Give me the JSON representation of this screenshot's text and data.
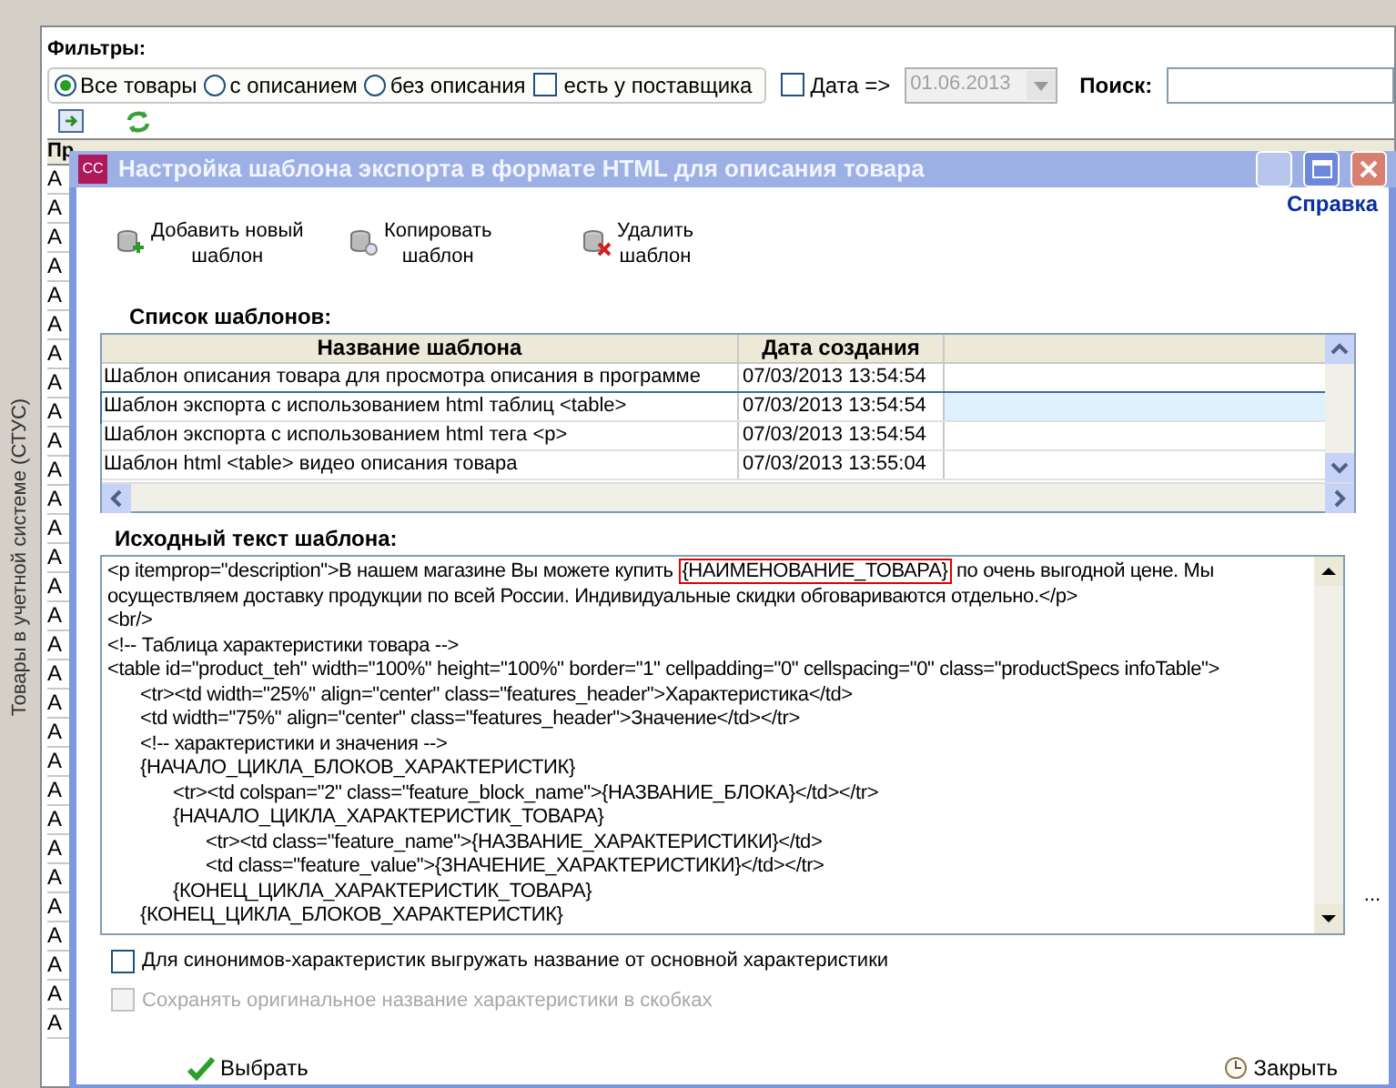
{
  "main": {
    "side_label": "Товары в учетной системе (СТУС)",
    "filters_title": "Фильтры:",
    "radios": [
      {
        "label": "Все товары",
        "selected": true
      },
      {
        "label": "с описанием",
        "selected": false
      },
      {
        "label": "без описания",
        "selected": false
      }
    ],
    "supplier": {
      "label": "есть у поставщика",
      "checked": false
    },
    "date": {
      "label": "Дата =>",
      "checked": false,
      "value": "01.06.2013"
    },
    "search": {
      "label": "Поиск:"
    },
    "grid_columns": [
      "Пр"
    ],
    "grid_rows": [
      "A",
      "A",
      "A",
      "A",
      "A",
      "A",
      "A",
      "A",
      "A",
      "A",
      "A",
      "A",
      "A",
      "A",
      "A",
      "A",
      "A",
      "A",
      "A",
      "A",
      "A",
      "A",
      "A",
      "A",
      "A",
      "A",
      "A",
      "A",
      "A",
      "A"
    ]
  },
  "dialog": {
    "logo": "CC",
    "title": "Настройка шаблона экспорта в формате HTML для описания товара",
    "help": "Справка",
    "toolbar": [
      {
        "kind": "add",
        "label": "Добавить новый\nшаблон"
      },
      {
        "kind": "copy",
        "label": "Копировать\nшаблон"
      },
      {
        "kind": "delete",
        "label": "Удалить\nшаблон"
      }
    ],
    "templates_title": "Список шаблонов:",
    "columns": [
      "Название шаблона",
      "Дата создания"
    ],
    "rows": [
      {
        "name": "Шаблон описания товара для просмотра описания в программе",
        "date": "07/03/2013 13:54:54",
        "selected": false
      },
      {
        "name": "Шаблон экспорта с использованием html таблиц <table>",
        "date": "07/03/2013 13:54:54",
        "selected": true
      },
      {
        "name": "Шаблон экспорта с использованием html тега <p>",
        "date": "07/03/2013 13:54:54",
        "selected": false
      },
      {
        "name": "Шаблон html <table> видео описания товара",
        "date": "07/03/2013 13:55:04",
        "selected": false
      }
    ],
    "source_title": "Исходный текст шаблона:",
    "source": {
      "before": "<p itemprop=\"description\">В нашем магазине Вы можете купить ",
      "highlight": "{НАИМЕНОВАНИЕ_ТОВАРА}",
      "after": " по очень выгодной цене. Мы осуществляем доставку продукции по всей России. Индивидуальные скидки обговариваются отдельно.</p>",
      "lines": [
        {
          "text": "<br/>"
        },
        {
          "text": "<!-- Таблица характеристики товара -->"
        },
        {
          "text": "<table id=\"product_teh\" width=\"100%\" height=\"100%\" border=\"1\" cellpadding=\"0\" cellspacing=\"0\" class=\"productSpecs infoTable\">",
          "children": [
            {
              "text": "<tr><td width=\"25%\" align=\"center\" class=\"features_header\">Характеристика</td>"
            },
            {
              "text": "<td width=\"75%\" align=\"center\" class=\"features_header\">Значение</td></tr>"
            },
            {
              "text": "<!-- характеристики и значения -->"
            },
            {
              "text": "{НАЧАЛО_ЦИКЛА_БЛОКОВ_ХАРАКТЕРИСТИК}",
              "children": [
                {
                  "text": "<tr><td colspan=\"2\" class=\"feature_block_name\">{НАЗВАНИЕ_БЛОКА}</td></tr>"
                },
                {
                  "text": "{НАЧАЛО_ЦИКЛА_ХАРАКТЕРИСТИК_ТОВАРА}",
                  "children": [
                    {
                      "text": "<tr><td class=\"feature_name\">{НАЗВАНИЕ_ХАРАКТЕРИСТИКИ}</td>"
                    },
                    {
                      "text": "<td class=\"feature_value\">{ЗНАЧЕНИЕ_ХАРАКТЕРИСТИКИ}</td></tr>"
                    }
                  ]
                },
                {
                  "text": "{КОНЕЦ_ЦИКЛА_ХАРАКТЕРИСТИК_ТОВАРА}"
                }
              ]
            },
            {
              "text": "{КОНЕЦ_ЦИКЛА_БЛОКОВ_ХАРАКТЕРИСТИК}"
            }
          ]
        }
      ]
    },
    "more": "...",
    "options": [
      {
        "label": "Для синонимов-характеристик выгружать название от основной характеристики",
        "checked": false,
        "disabled": false
      },
      {
        "label": "Сохранять оригинальное название характеристики в скобках",
        "checked": false,
        "disabled": true
      }
    ],
    "ok": "Выбрать",
    "close": "Закрыть"
  }
}
